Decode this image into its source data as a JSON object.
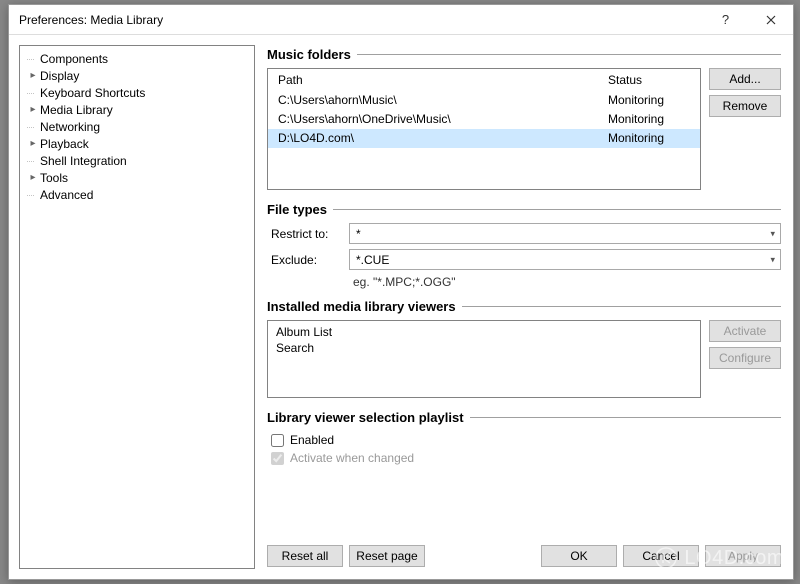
{
  "window": {
    "title": "Preferences: Media Library"
  },
  "sidebar": {
    "items": [
      {
        "label": "Components",
        "expandable": false
      },
      {
        "label": "Display",
        "expandable": true
      },
      {
        "label": "Keyboard Shortcuts",
        "expandable": false
      },
      {
        "label": "Media Library",
        "expandable": true,
        "selected": true
      },
      {
        "label": "Networking",
        "expandable": false
      },
      {
        "label": "Playback",
        "expandable": true
      },
      {
        "label": "Shell Integration",
        "expandable": false
      },
      {
        "label": "Tools",
        "expandable": true
      },
      {
        "label": "Advanced",
        "expandable": false
      }
    ]
  },
  "sections": {
    "music_folders": {
      "title": "Music folders",
      "columns": {
        "path": "Path",
        "status": "Status"
      },
      "rows": [
        {
          "path": "C:\\Users\\ahorn\\Music\\",
          "status": "Monitoring",
          "selected": false
        },
        {
          "path": "C:\\Users\\ahorn\\OneDrive\\Music\\",
          "status": "Monitoring",
          "selected": false
        },
        {
          "path": "D:\\LO4D.com\\",
          "status": "Monitoring",
          "selected": true
        }
      ],
      "buttons": {
        "add": "Add...",
        "remove": "Remove"
      }
    },
    "file_types": {
      "title": "File types",
      "restrict_label": "Restrict to:",
      "restrict_value": "*",
      "exclude_label": "Exclude:",
      "exclude_value": "*.CUE",
      "hint": "eg. \"*.MPC;*.OGG\""
    },
    "viewers": {
      "title": "Installed media library viewers",
      "items": [
        "Album List",
        "Search"
      ],
      "buttons": {
        "activate": "Activate",
        "configure": "Configure"
      }
    },
    "playlist": {
      "title": "Library viewer selection playlist",
      "enabled_label": "Enabled",
      "activate_label": "Activate when changed"
    }
  },
  "footer": {
    "reset_all": "Reset all",
    "reset_page": "Reset page",
    "ok": "OK",
    "cancel": "Cancel",
    "apply": "Apply"
  },
  "watermark": "LO4D.com"
}
